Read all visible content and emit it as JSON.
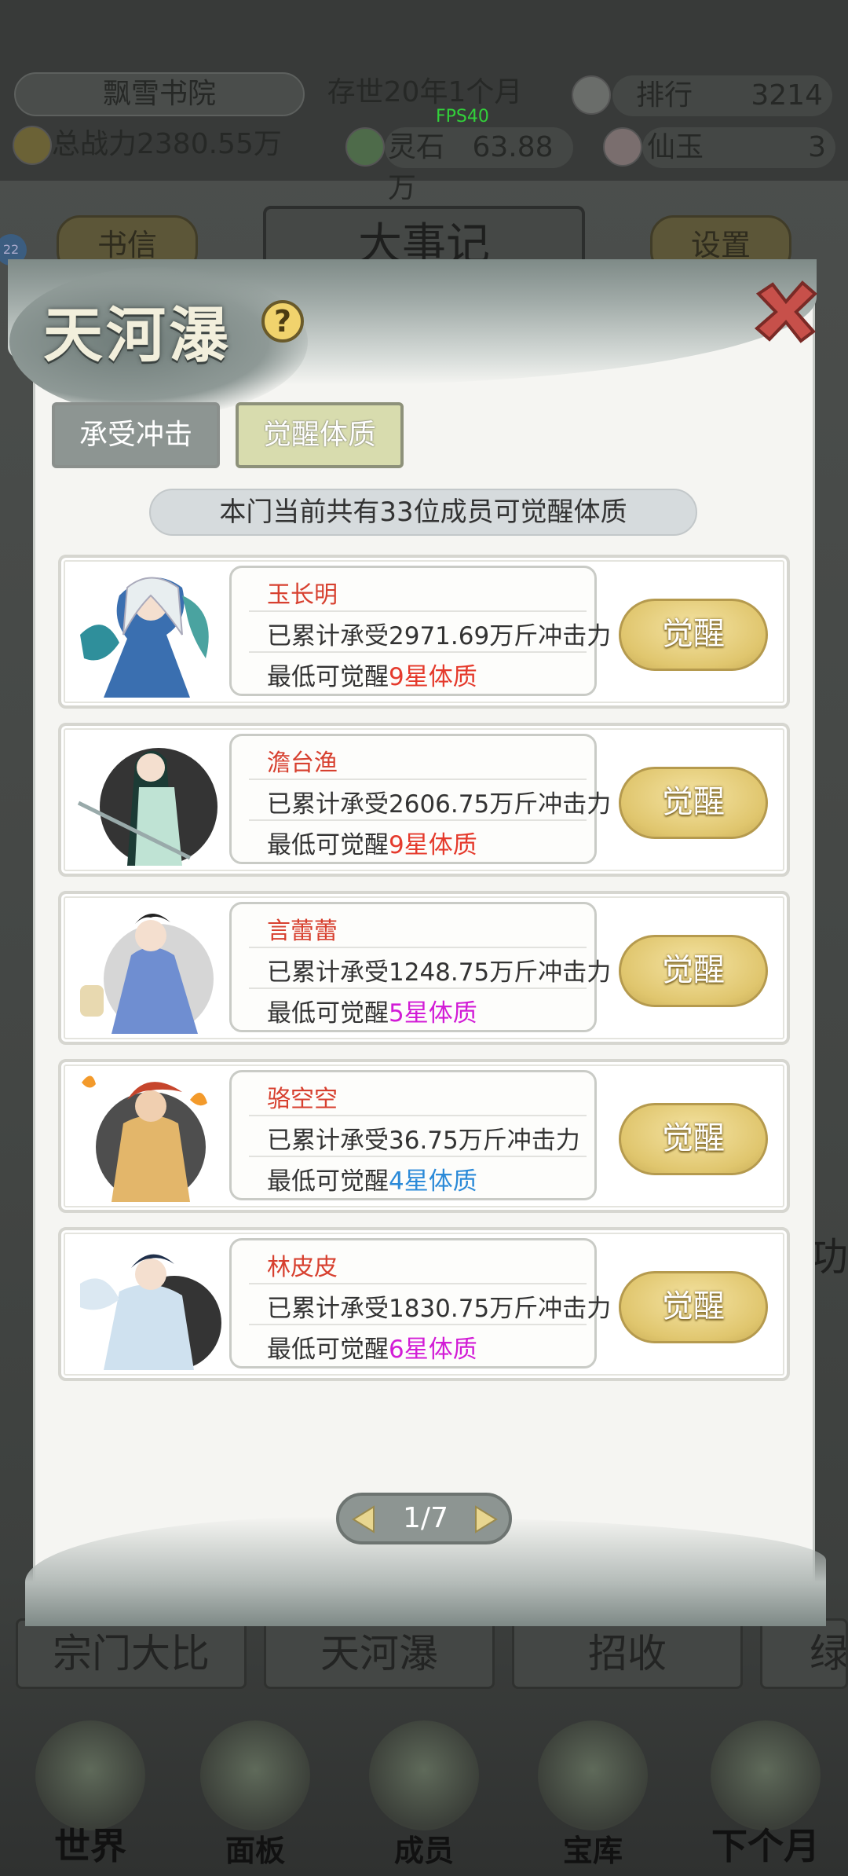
{
  "background": {
    "sect_name": "飘雪书院",
    "age_text": "存世20年1个月",
    "rank_label": "排行",
    "rank_value": "3214",
    "power_text": "总战力2380.55万",
    "fps": "FPS40",
    "spirit_stone_label": "灵石",
    "spirit_stone_value": "63.88万",
    "jade_label": "仙玉",
    "jade_value": "3",
    "badge_count": "22",
    "letters_button": "书信",
    "events_title": "大事记",
    "settings_button": "设置",
    "side_char": "功",
    "bottom_tabs": [
      "宗门大比",
      "天河瀑",
      "招收",
      "绿"
    ],
    "nav": [
      "世界",
      "面板",
      "成员",
      "宝库",
      "下个月"
    ]
  },
  "modal": {
    "title": "天河瀑",
    "help": "?",
    "tabs": [
      "承受冲击",
      "觉醒体质"
    ],
    "active_tab": "觉醒体质",
    "info": "本门当前共有33位成员可觉醒体质",
    "members": [
      {
        "name": "玉长明",
        "impact": "已累计承受2971.69万斤冲击力",
        "min_prefix": "最低可觉醒",
        "min_grade": "9星体质",
        "grade_color": "#e53a2c",
        "button": "觉醒"
      },
      {
        "name": "澹台渔",
        "impact": "已累计承受2606.75万斤冲击力",
        "min_prefix": "最低可觉醒",
        "min_grade": "9星体质",
        "grade_color": "#e53a2c",
        "button": "觉醒"
      },
      {
        "name": "言蕾蕾",
        "impact": "已累计承受1248.75万斤冲击力",
        "min_prefix": "最低可觉醒",
        "min_grade": "5星体质",
        "grade_color": "#d21cd6",
        "button": "觉醒"
      },
      {
        "name": "骆空空",
        "impact": "已累计承受36.75万斤冲击力",
        "min_prefix": "最低可觉醒",
        "min_grade": "4星体质",
        "grade_color": "#2b8ad8",
        "button": "觉醒"
      },
      {
        "name": "林皮皮",
        "impact": "已累计承受1830.75万斤冲击力",
        "min_prefix": "最低可觉醒",
        "min_grade": "6星体质",
        "grade_color": "#d21cd6",
        "button": "觉醒"
      }
    ],
    "pager": "1/7"
  }
}
